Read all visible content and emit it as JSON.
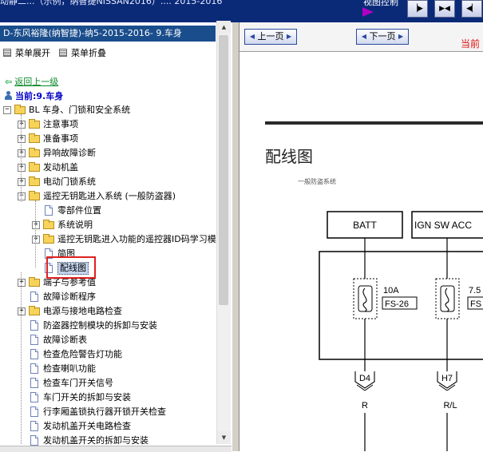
{
  "topbar": {
    "title_partial": "动静二...（示例，纳智捷NISSAN2016）....  2015-2016",
    "view_control": "视图控制",
    "buttons": [
      "pane-right-button",
      "pane-split-button",
      "pane-left-button"
    ]
  },
  "left_pane": {
    "doc_title": "D-东风裕隆(纳智捷)-纳5-2015-2016- 9.车身",
    "menu": {
      "expand_label": "菜单展开",
      "collapse_label": "菜单折叠"
    },
    "back_label": "返回上一级",
    "current_label": "当前:9.车身",
    "tree": [
      {
        "label": "BL 车身、门锁和安全系统",
        "kind": "folder",
        "expander": "−"
      },
      {
        "label": "注意事项",
        "kind": "folder",
        "expander": "+"
      },
      {
        "label": "准备事项",
        "kind": "folder",
        "expander": "+"
      },
      {
        "label": "异响故障诊断",
        "kind": "folder",
        "expander": "+"
      },
      {
        "label": "发动机盖",
        "kind": "folder",
        "expander": "+"
      },
      {
        "label": "电动门锁系统",
        "kind": "folder",
        "expander": "+"
      },
      {
        "label": "遥控无钥匙进入系统 (一般防盗器)",
        "kind": "folder",
        "expander": "−"
      },
      {
        "label": "零部件位置",
        "kind": "page",
        "expander": ""
      },
      {
        "label": "系统说明",
        "kind": "folder",
        "expander": "+"
      },
      {
        "label": "遥控无钥匙进入功能的遥控器ID码学习模",
        "kind": "folder",
        "expander": "+"
      },
      {
        "label": "简图",
        "kind": "page",
        "expander": ""
      },
      {
        "label": "配线图",
        "kind": "page",
        "expander": "",
        "selected": true
      },
      {
        "label": "端子与参考值",
        "kind": "folder",
        "expander": "+"
      },
      {
        "label": "故障诊断程序",
        "kind": "page",
        "expander": ""
      },
      {
        "label": "电源与接地电路检查",
        "kind": "folder",
        "expander": "+"
      },
      {
        "label": "防盗器控制模块的拆卸与安装",
        "kind": "page",
        "expander": ""
      },
      {
        "label": "故障诊断表",
        "kind": "page",
        "expander": ""
      },
      {
        "label": "检查危险警告灯功能",
        "kind": "page",
        "expander": ""
      },
      {
        "label": "检查喇叭功能",
        "kind": "page",
        "expander": ""
      },
      {
        "label": "检查车门开关信号",
        "kind": "page",
        "expander": ""
      },
      {
        "label": "车门开关的拆卸与安装",
        "kind": "page",
        "expander": ""
      },
      {
        "label": "行李厢盖锁执行器开锁开关检查",
        "kind": "page",
        "expander": ""
      },
      {
        "label": "发动机盖开关电路检查",
        "kind": "page",
        "expander": ""
      },
      {
        "label": "发动机盖开关的拆卸与安装",
        "kind": "page",
        "expander": ""
      }
    ]
  },
  "right_pane": {
    "prev_label": "上一页",
    "next_label": "下一页",
    "red_text": "当前",
    "diagram": {
      "title": "配线图",
      "subtitle": "一般防盗系统",
      "box_batt": "BATT",
      "box_ign": "IGN SW ACC",
      "fuse1_amp": "10A",
      "fuse1_id": "FS-26",
      "fuse2_amp": "7.5",
      "fuse2_id": "FS",
      "conn1": "D4",
      "conn2": "H7",
      "wire1": "R",
      "wire2": "R/L"
    }
  },
  "colors": {
    "topbar": "#0a2a78",
    "title_bar": "#1a4d8c",
    "back_link": "#0a8a2a",
    "current": "#0000c8",
    "highlight_box": "#e02020",
    "nav_red": "#e01010"
  }
}
